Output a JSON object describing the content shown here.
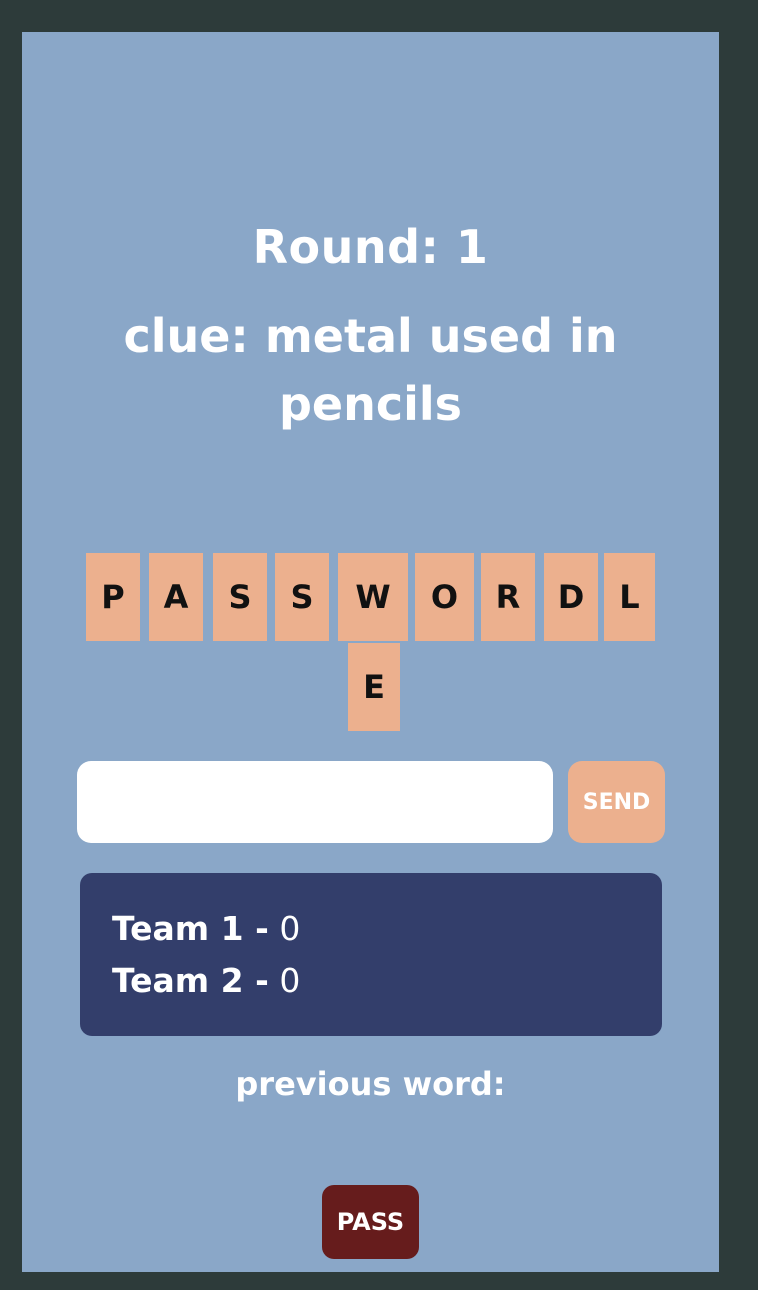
{
  "game": {
    "round_label": "Round: 1",
    "clue_label": "clue: metal used in pencils"
  },
  "word_tiles": [
    "P",
    "A",
    "S",
    "S",
    "W",
    "O",
    "R",
    "D",
    "L",
    "E"
  ],
  "guess": {
    "value": "",
    "placeholder": "",
    "send_label": "SEND"
  },
  "scores": {
    "team1_name": "Team 1 -",
    "team1_score": "0",
    "team2_name": "Team 2 -",
    "team2_score": "0"
  },
  "previous_word_label": "previous word:",
  "pass_label": "PASS",
  "colors": {
    "outer_background": "#2d3b3a",
    "panel_background": "#8aa7c8",
    "tile": "#ecb08e",
    "scoreboard": "#333e6b",
    "pass_button": "#661c1c"
  }
}
